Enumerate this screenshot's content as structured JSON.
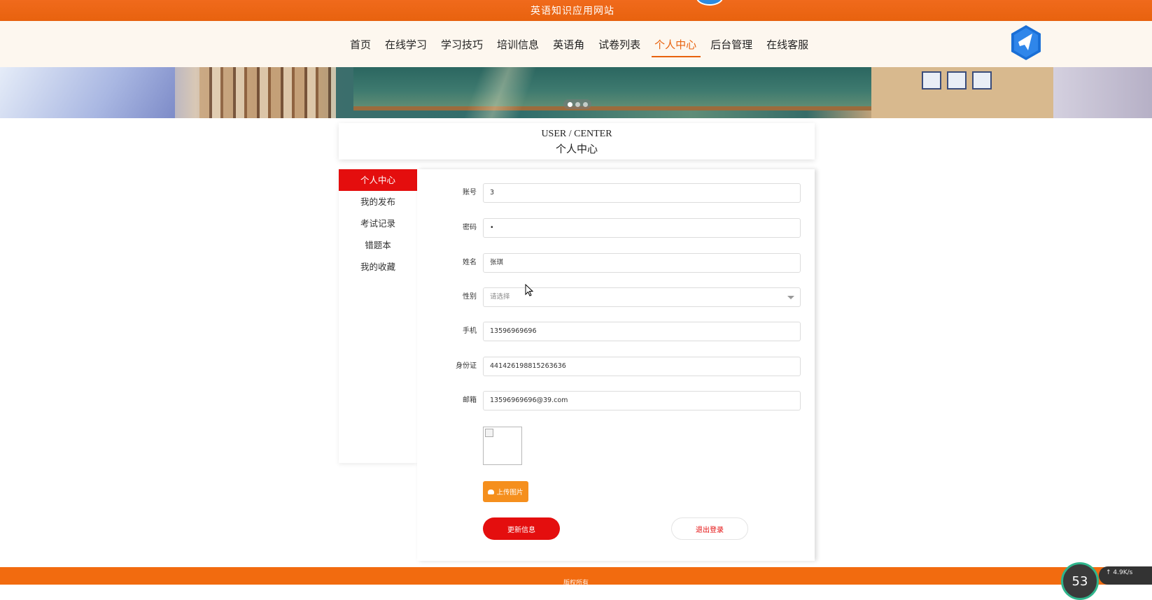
{
  "topbar": {
    "site_title": "英语知识应用网站"
  },
  "nav": {
    "items": [
      {
        "label": "首页"
      },
      {
        "label": "在线学习"
      },
      {
        "label": "学习技巧"
      },
      {
        "label": "培训信息"
      },
      {
        "label": "英语角"
      },
      {
        "label": "试卷列表"
      },
      {
        "label": "个人中心",
        "active": true
      },
      {
        "label": "后台管理"
      },
      {
        "label": "在线客服"
      }
    ]
  },
  "section": {
    "title_en": "USER / CENTER",
    "title_cn": "个人中心"
  },
  "sidebar": {
    "items": [
      {
        "label": "个人中心",
        "active": true
      },
      {
        "label": "我的发布"
      },
      {
        "label": "考试记录"
      },
      {
        "label": "错题本"
      },
      {
        "label": "我的收藏"
      }
    ]
  },
  "form": {
    "account": {
      "label": "账号",
      "value": "3"
    },
    "password": {
      "label": "密码",
      "value": "•"
    },
    "name": {
      "label": "姓名",
      "value": "张琪"
    },
    "gender": {
      "label": "性别",
      "placeholder": "请选择"
    },
    "phone": {
      "label": "手机",
      "value": "13596969696"
    },
    "id_card": {
      "label": "身份证",
      "value": "441426198815263636"
    },
    "email": {
      "label": "邮箱",
      "value": "13596969696@39.com"
    }
  },
  "buttons": {
    "upload": "上传图片",
    "update": "更新信息",
    "logout": "退出登录"
  },
  "footer": {
    "text": "版权所有"
  },
  "overlay": {
    "speed_ring": "53",
    "speed_text": "↑ 4.9K/s"
  },
  "colors": {
    "primary_orange": "#e8620e",
    "accent_red": "#e40e0e",
    "upload_orange": "#f58f1d"
  },
  "icons": [
    "brand-logo-icon",
    "cloud-upload-icon",
    "chevron-down-icon",
    "broken-image-icon",
    "mouse-cursor-icon"
  ]
}
